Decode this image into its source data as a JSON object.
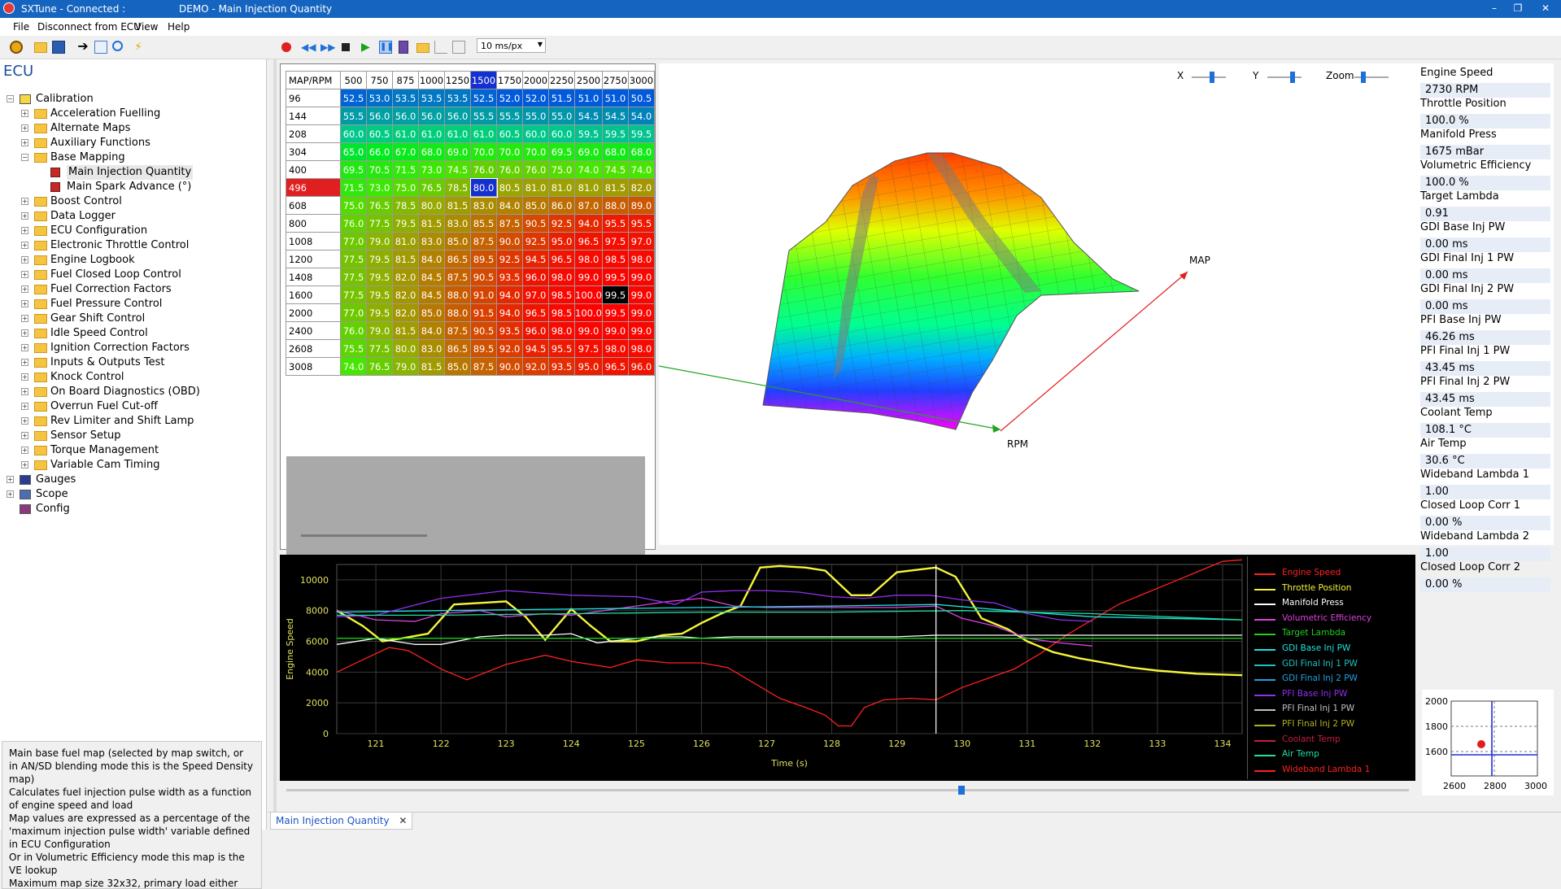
{
  "window": {
    "app_title": "SXTune - Connected :",
    "doc_title": "DEMO - Main Injection Quantity",
    "minimize": "–",
    "restore": "❐",
    "close": "✕"
  },
  "menu": [
    "File",
    "Disconnect from ECU",
    "View",
    "Help"
  ],
  "toolbar": {
    "timescale": "10 ms/px",
    "icons": [
      "open-icon",
      "folder-icon",
      "save-icon",
      "connect-icon",
      "copy-icon",
      "search-icon",
      "lightning-icon",
      "record-icon",
      "rewind-icon",
      "fast-forward-icon",
      "stop-icon",
      "play-icon",
      "pause-icon",
      "calculator-icon",
      "folder-icon",
      "chart-icon",
      "grid-icon"
    ]
  },
  "sidebar": {
    "title": "ECU",
    "root": "Calibration",
    "items": [
      "Acceleration Fuelling",
      "Alternate Maps",
      "Auxiliary Functions",
      "Base Mapping",
      "Boost Control",
      "Data Logger",
      "ECU Configuration",
      "Electronic Throttle Control",
      "Engine Logbook",
      "Fuel Closed Loop Control",
      "Fuel Correction Factors",
      "Fuel Pressure Control",
      "Gear Shift Control",
      "Idle Speed Control",
      "Ignition Correction Factors",
      "Inputs & Outputs Test",
      "Knock Control",
      "On Board Diagnostics (OBD)",
      "Overrun Fuel Cut-off",
      "Rev Limiter and Shift Lamp",
      "Sensor Setup",
      "Torque Management",
      "Variable Cam Timing"
    ],
    "base_mapping_children": [
      "Main Injection Quantity",
      "Main Spark Advance (°)"
    ],
    "other_roots": [
      "Gauges",
      "Scope",
      "Config"
    ]
  },
  "description": [
    "Main base fuel map (selected by map switch, or in AN/SD blending mode this is the Speed Density map)",
    "Calculates fuel injection pulse width as a function of engine speed and load",
    "Map values are expressed as a percentage of the 'maximum injection pulse width' variable defined in ECU Configuration",
    "Or in Volumetric Efficiency mode this map is the VE lookup",
    "Maximum map size 32x32, primary load either"
  ],
  "map_table": {
    "corner": "MAP/RPM",
    "rpm": [
      "500",
      "750",
      "875",
      "1000",
      "1250",
      "1500",
      "1750",
      "2000",
      "2250",
      "2500",
      "2750",
      "3000"
    ],
    "selected_rpm": "1500",
    "selected_map": "496",
    "rows": [
      {
        "map": "96",
        "values": [
          "52.5",
          "53.0",
          "53.5",
          "53.5",
          "53.5",
          "52.5",
          "52.0",
          "52.0",
          "51.5",
          "51.0",
          "51.0",
          "50.5"
        ]
      },
      {
        "map": "144",
        "values": [
          "55.5",
          "56.0",
          "56.0",
          "56.0",
          "56.0",
          "55.5",
          "55.5",
          "55.0",
          "55.0",
          "54.5",
          "54.5",
          "54.0"
        ]
      },
      {
        "map": "208",
        "values": [
          "60.0",
          "60.5",
          "61.0",
          "61.0",
          "61.0",
          "61.0",
          "60.5",
          "60.0",
          "60.0",
          "59.5",
          "59.5",
          "59.5"
        ]
      },
      {
        "map": "304",
        "values": [
          "65.0",
          "66.0",
          "67.0",
          "68.0",
          "69.0",
          "70.0",
          "70.0",
          "70.0",
          "69.5",
          "69.0",
          "68.0",
          "68.0"
        ]
      },
      {
        "map": "400",
        "values": [
          "69.5",
          "70.5",
          "71.5",
          "73.0",
          "74.5",
          "76.0",
          "76.0",
          "76.0",
          "75.0",
          "74.0",
          "74.5",
          "74.0"
        ]
      },
      {
        "map": "496",
        "values": [
          "71.5",
          "73.0",
          "75.0",
          "76.5",
          "78.5",
          "80.0",
          "80.5",
          "81.0",
          "81.0",
          "81.0",
          "81.5",
          "82.0"
        ]
      },
      {
        "map": "608",
        "values": [
          "75.0",
          "76.5",
          "78.5",
          "80.0",
          "81.5",
          "83.0",
          "84.0",
          "85.0",
          "86.0",
          "87.0",
          "88.0",
          "89.0"
        ]
      },
      {
        "map": "800",
        "values": [
          "76.0",
          "77.5",
          "79.5",
          "81.5",
          "83.0",
          "85.5",
          "87.5",
          "90.5",
          "92.5",
          "94.0",
          "95.5",
          "95.5"
        ]
      },
      {
        "map": "1008",
        "values": [
          "77.0",
          "79.0",
          "81.0",
          "83.0",
          "85.0",
          "87.5",
          "90.0",
          "92.5",
          "95.0",
          "96.5",
          "97.5",
          "97.0"
        ]
      },
      {
        "map": "1200",
        "values": [
          "77.5",
          "79.5",
          "81.5",
          "84.0",
          "86.5",
          "89.5",
          "92.5",
          "94.5",
          "96.5",
          "98.0",
          "98.5",
          "98.0"
        ]
      },
      {
        "map": "1408",
        "values": [
          "77.5",
          "79.5",
          "82.0",
          "84.5",
          "87.5",
          "90.5",
          "93.5",
          "96.0",
          "98.0",
          "99.0",
          "99.5",
          "99.0"
        ]
      },
      {
        "map": "1600",
        "values": [
          "77.5",
          "79.5",
          "82.0",
          "84.5",
          "88.0",
          "91.0",
          "94.0",
          "97.0",
          "98.5",
          "100.0",
          "99.5",
          "99.0"
        ]
      },
      {
        "map": "2000",
        "values": [
          "77.0",
          "79.5",
          "82.0",
          "85.0",
          "88.0",
          "91.5",
          "94.0",
          "96.5",
          "98.5",
          "100.0",
          "99.5",
          "99.0"
        ]
      },
      {
        "map": "2400",
        "values": [
          "76.0",
          "79.0",
          "81.5",
          "84.0",
          "87.5",
          "90.5",
          "93.5",
          "96.0",
          "98.0",
          "99.0",
          "99.0",
          "99.0"
        ]
      },
      {
        "map": "2608",
        "values": [
          "75.5",
          "77.5",
          "80.0",
          "83.0",
          "86.5",
          "89.5",
          "92.0",
          "94.5",
          "95.5",
          "97.5",
          "98.0",
          "98.0"
        ]
      },
      {
        "map": "3008",
        "values": [
          "74.0",
          "76.5",
          "79.0",
          "81.5",
          "85.0",
          "87.5",
          "90.0",
          "92.0",
          "93.5",
          "95.0",
          "96.5",
          "96.0"
        ]
      }
    ]
  },
  "view3d": {
    "controls": [
      "X",
      "Y",
      "Zoom"
    ],
    "axis_rpm": "RPM",
    "axis_map": "MAP",
    "axis_rpm_color": "#22a422",
    "axis_map_color": "#e02020"
  },
  "live": [
    {
      "label": "Engine Speed",
      "value": "2730 RPM"
    },
    {
      "label": "Throttle Position",
      "value": "100.0 %"
    },
    {
      "label": "Manifold Press",
      "value": "1675 mBar"
    },
    {
      "label": "Volumetric Efficiency",
      "value": "100.0 %"
    },
    {
      "label": "Target Lambda",
      "value": "0.91"
    },
    {
      "label": "GDI Base Inj PW",
      "value": "0.00 ms"
    },
    {
      "label": "GDI Final Inj 1 PW",
      "value": "0.00 ms"
    },
    {
      "label": "GDI Final Inj 2 PW",
      "value": "0.00 ms"
    },
    {
      "label": "PFI Base Inj PW",
      "value": "46.26 ms"
    },
    {
      "label": "PFI Final Inj 1 PW",
      "value": "43.45 ms"
    },
    {
      "label": "PFI Final Inj 2 PW",
      "value": "43.45 ms"
    },
    {
      "label": "Coolant Temp",
      "value": "108.1 °C"
    },
    {
      "label": "Air Temp",
      "value": "30.6 °C"
    },
    {
      "label": "Wideband Lambda 1",
      "value": "1.00"
    },
    {
      "label": "Closed Loop Corr 1",
      "value": "0.00 %"
    },
    {
      "label": "Wideband Lambda 2",
      "value": "1.00"
    },
    {
      "label": "Closed Loop Corr 2",
      "value": "0.00 %"
    }
  ],
  "chart_data": {
    "type": "line",
    "xlabel": "Time (s)",
    "ylabel": "Engine Speed",
    "xlim": [
      120.4,
      134.3
    ],
    "ylim": [
      0,
      11000
    ],
    "xticks": [
      121,
      122,
      123,
      124,
      125,
      126,
      127,
      128,
      129,
      130,
      131,
      132,
      133,
      134
    ],
    "yticks": [
      0,
      2000,
      4000,
      6000,
      8000,
      10000
    ],
    "cursor_x": 129.6,
    "series": [
      {
        "name": "Engine Speed",
        "color": "#ff2020",
        "x": [
          120.4,
          120.8,
          121.2,
          121.5,
          122.0,
          122.4,
          123.0,
          123.6,
          124.0,
          124.6,
          125.0,
          125.5,
          126.0,
          126.4,
          126.8,
          127.2,
          127.6,
          127.9,
          128.1,
          128.3,
          128.5,
          128.8,
          129.2,
          129.6,
          130.0,
          130.4,
          130.8,
          131.2,
          131.6,
          132.0,
          132.4,
          132.8,
          133.2,
          133.6,
          134.0,
          134.3
        ],
        "y": [
          4000,
          4800,
          5600,
          5400,
          4200,
          3500,
          4500,
          5100,
          4700,
          4300,
          4800,
          4600,
          4600,
          4300,
          3300,
          2300,
          1700,
          1200,
          500,
          500,
          1700,
          2200,
          2300,
          2200,
          3000,
          3600,
          4200,
          5200,
          6400,
          7400,
          8400,
          9100,
          9800,
          10500,
          11200,
          11300
        ]
      },
      {
        "name": "Throttle Position",
        "color": "#f5f53a",
        "x": [
          120.4,
          120.8,
          121.1,
          121.4,
          121.8,
          122.2,
          122.6,
          123.0,
          123.3,
          123.6,
          124.0,
          124.3,
          124.6,
          125.0,
          125.4,
          125.7,
          126.0,
          126.3,
          126.6,
          126.9,
          127.2,
          127.6,
          127.9,
          128.3,
          128.6,
          129.0,
          129.4,
          129.6,
          129.9,
          130.3,
          130.7,
          131.0,
          131.4,
          131.8,
          132.2,
          132.6,
          133.0,
          133.6,
          134.3
        ],
        "y": [
          8000,
          7000,
          6000,
          6200,
          6500,
          8400,
          8500,
          8600,
          7600,
          6100,
          8100,
          7000,
          6000,
          6000,
          6400,
          6500,
          7200,
          7800,
          8300,
          10800,
          10900,
          10800,
          10600,
          9000,
          9000,
          10500,
          10700,
          10800,
          10200,
          7500,
          6800,
          6000,
          5300,
          4900,
          4600,
          4300,
          4100,
          3900,
          3800
        ]
      },
      {
        "name": "Manifold Press",
        "color": "#ffffff",
        "x": [
          120.4,
          121.0,
          121.6,
          122.0,
          122.6,
          123.0,
          123.6,
          124.0,
          124.4,
          124.8,
          125.3,
          125.7,
          126.0,
          126.5,
          127.0,
          127.5,
          128.0,
          128.5,
          129.0,
          129.6,
          130.0,
          131.0,
          132.0,
          133.0,
          134.3
        ],
        "y": [
          5800,
          6200,
          5800,
          5800,
          6300,
          6400,
          6400,
          6500,
          5900,
          6100,
          6300,
          6300,
          6200,
          6300,
          6300,
          6300,
          6300,
          6300,
          6300,
          6400,
          6400,
          6400,
          6400,
          6400,
          6400
        ]
      },
      {
        "name": "Volumetric Efficiency",
        "color": "#e040e0",
        "x": [
          120.4,
          121.0,
          121.6,
          122.0,
          122.6,
          123.0,
          123.6,
          124.0,
          124.5,
          125.0,
          125.5,
          126.0,
          126.5,
          127.0,
          127.5,
          128.0,
          128.5,
          129.0,
          129.6,
          130.0,
          130.5,
          131.0,
          131.5,
          132.0
        ],
        "y": [
          8000,
          7400,
          7300,
          7800,
          8000,
          7600,
          7800,
          7700,
          8000,
          8300,
          8600,
          8800,
          8300,
          8200,
          8200,
          8200,
          8200,
          8200,
          8300,
          7500,
          7000,
          6200,
          5900,
          5700
        ]
      },
      {
        "name": "Target Lambda",
        "color": "#20d020",
        "x": [
          120.4,
          122.0,
          124.0,
          126.0,
          128.0,
          129.6,
          130.5,
          132.0,
          134.3
        ],
        "y": [
          6200,
          6200,
          6200,
          6200,
          6200,
          6200,
          6200,
          6200,
          6200
        ]
      },
      {
        "name": "GDI Base Inj PW",
        "color": "#20e0e0",
        "x": [
          120.4,
          122.0,
          124.0,
          126.0,
          128.0,
          129.6,
          131.0,
          132.0,
          134.3
        ],
        "y": [
          7900,
          8000,
          8100,
          8200,
          8300,
          8400,
          7900,
          7600,
          7400
        ]
      },
      {
        "name": "PFI Base Inj PW",
        "color": "#9030f0",
        "x": [
          120.4,
          121.0,
          122.0,
          123.0,
          124.0,
          125.0,
          125.6,
          126.0,
          126.5,
          127.0,
          127.5,
          128.0,
          128.5,
          129.0,
          129.5,
          130.0,
          130.5,
          131.0,
          131.5,
          132.0
        ],
        "y": [
          7600,
          7700,
          8800,
          9300,
          9000,
          8900,
          8400,
          9200,
          9300,
          9300,
          9200,
          8900,
          8800,
          9000,
          9000,
          8700,
          8500,
          7800,
          7400,
          7300
        ]
      },
      {
        "name": "Air Temp",
        "color": "#20e0a0",
        "x": [
          120.4,
          122.0,
          124.0,
          126.0,
          128.0,
          130.0,
          132.0,
          134.3
        ],
        "y": [
          7700,
          7700,
          7800,
          7900,
          7900,
          8000,
          7800,
          7400
        ]
      }
    ]
  },
  "legend": [
    {
      "name": "Engine Speed",
      "color": "#ff2020"
    },
    {
      "name": "Throttle Position",
      "color": "#f5f53a"
    },
    {
      "name": "Manifold Press",
      "color": "#ffffff"
    },
    {
      "name": "Volumetric Efficiency",
      "color": "#e040e0"
    },
    {
      "name": "Target Lambda",
      "color": "#20d020"
    },
    {
      "name": "GDI Base Inj PW",
      "color": "#20e0e0"
    },
    {
      "name": "GDI Final Inj 1 PW",
      "color": "#20c0c0"
    },
    {
      "name": "GDI Final Inj 2 PW",
      "color": "#20a0e0"
    },
    {
      "name": "PFI Base Inj PW",
      "color": "#9030f0"
    },
    {
      "name": "PFI Final Inj 1 PW",
      "color": "#c0c0c0"
    },
    {
      "name": "PFI Final Inj 2 PW",
      "color": "#b0b020"
    },
    {
      "name": "Coolant Temp",
      "color": "#c02040"
    },
    {
      "name": "Air Temp",
      "color": "#20e0a0"
    },
    {
      "name": "Wideband Lambda 1",
      "color": "#ff2020"
    }
  ],
  "minimap": {
    "yticks": [
      "2000",
      "1800",
      "1600"
    ],
    "xticks": [
      "2600",
      "2800",
      "3000"
    ]
  },
  "tab": {
    "label": "Main Injection Quantity",
    "close": "✕"
  }
}
